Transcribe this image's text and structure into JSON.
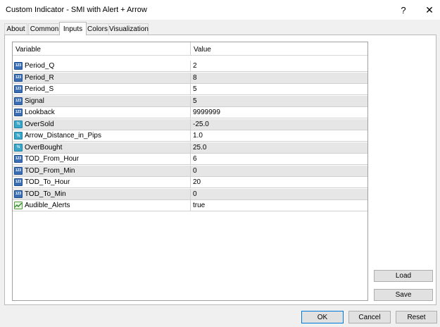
{
  "window": {
    "title": "Custom Indicator - SMI with Alert + Arrow",
    "help_label": "?",
    "close_label": "✕"
  },
  "tabs": [
    {
      "label": "About"
    },
    {
      "label": "Common"
    },
    {
      "label": "Inputs"
    },
    {
      "label": "Colors"
    },
    {
      "label": "Visualization"
    }
  ],
  "active_tab": "Inputs",
  "grid": {
    "columns": [
      "Variable",
      "Value"
    ],
    "rows": [
      {
        "name": "Period_Q",
        "value": "2",
        "type": "int"
      },
      {
        "name": "Period_R",
        "value": "8",
        "type": "int"
      },
      {
        "name": "Period_S",
        "value": "5",
        "type": "int"
      },
      {
        "name": "Signal",
        "value": "5",
        "type": "int"
      },
      {
        "name": "Lookback",
        "value": "9999999",
        "type": "int"
      },
      {
        "name": "OverSold",
        "value": "-25.0",
        "type": "double"
      },
      {
        "name": "Arrow_Distance_in_Pips",
        "value": "1.0",
        "type": "double"
      },
      {
        "name": "OverBought",
        "value": "25.0",
        "type": "double"
      },
      {
        "name": "TOD_From_Hour",
        "value": "6",
        "type": "int"
      },
      {
        "name": "TOD_From_Min",
        "value": "0",
        "type": "int"
      },
      {
        "name": "TOD_To_Hour",
        "value": "20",
        "type": "int"
      },
      {
        "name": "TOD_To_Min",
        "value": "0",
        "type": "int"
      },
      {
        "name": "Audible_Alerts",
        "value": "true",
        "type": "bool"
      }
    ]
  },
  "type_icons": {
    "int": {
      "icon": "integer-icon",
      "glyph": "123"
    },
    "double": {
      "icon": "double-icon",
      "glyph": "½"
    },
    "bool": {
      "icon": "boolean-icon",
      "glyph": ""
    }
  },
  "buttons": {
    "load": "Load",
    "save": "Save",
    "ok": "OK",
    "cancel": "Cancel",
    "reset": "Reset"
  },
  "colors": {
    "row_alt": "#e6e6e6",
    "ok_border": "#0078d7"
  }
}
